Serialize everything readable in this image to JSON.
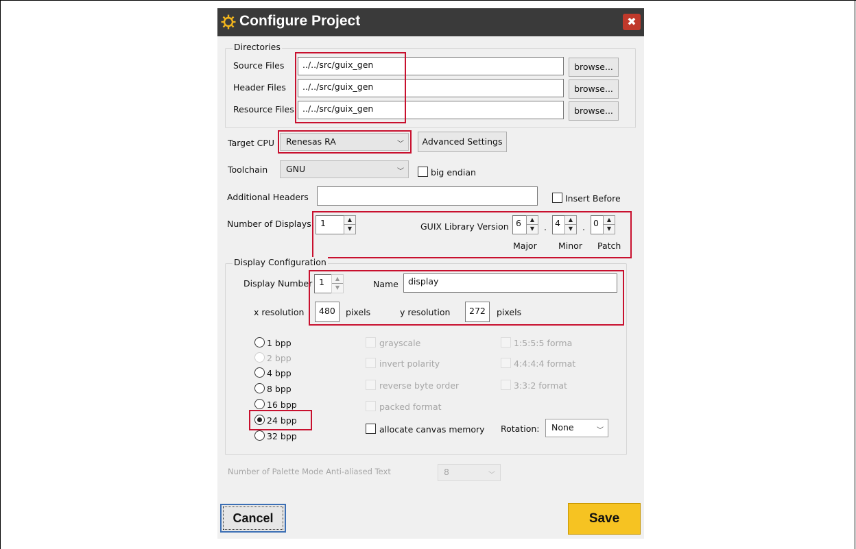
{
  "dialog": {
    "title": "Configure Project",
    "close_glyph": "✖"
  },
  "directories": {
    "group_label": "Directories",
    "source": {
      "label": "Source Files",
      "value": "../../src/guix_gen",
      "browse": "browse..."
    },
    "header": {
      "label": "Header Files",
      "value": "../../src/guix_gen",
      "browse": "browse..."
    },
    "resource": {
      "label": "Resource Files",
      "value": "../../src/guix_gen",
      "browse": "browse..."
    }
  },
  "target_cpu": {
    "label": "Target CPU",
    "value": "Renesas RA",
    "advanced": "Advanced Settings"
  },
  "toolchain": {
    "label": "Toolchain",
    "value": "GNU",
    "big_endian": "big endian"
  },
  "additional_headers": {
    "label": "Additional Headers",
    "value": "",
    "insert_before": "Insert Before"
  },
  "displays": {
    "label": "Number of Displays",
    "value": "1"
  },
  "guix_version": {
    "label": "GUIX Library Version",
    "major": "6",
    "minor": "4",
    "patch": "0",
    "sep": ".",
    "major_label": "Major",
    "minor_label": "Minor",
    "patch_label": "Patch"
  },
  "display_config": {
    "group_label": "Display Configuration",
    "number_label": "Display Number",
    "number_value": "1",
    "name_label": "Name",
    "name_value": "display",
    "xres_label": "x resolution",
    "xres_value": "480",
    "yres_label": "y resolution",
    "yres_value": "272",
    "pixels": "pixels",
    "bpp": [
      "1 bpp",
      "2 bpp",
      "4 bpp",
      "8 bpp",
      "16 bpp",
      "24 bpp",
      "32 bpp"
    ],
    "bpp_selected": "24 bpp",
    "options": [
      "grayscale",
      "invert polarity",
      "reverse byte order",
      "packed format"
    ],
    "formats": [
      "1:5:5:5 forma",
      "4:4:4:4 format",
      "3:3:2 format"
    ],
    "allocate_canvas": "allocate canvas memory",
    "rotation_label": "Rotation:",
    "rotation_value": "None"
  },
  "palette": {
    "label": "Number of Palette Mode Anti-aliased Text",
    "value": "8"
  },
  "buttons": {
    "cancel": "Cancel",
    "save": "Save"
  },
  "icons": {
    "title_icon": "gear-icon",
    "close": "close-icon"
  },
  "colors": {
    "highlight": "#c8102e",
    "save": "#f6c322",
    "titlebar": "#3a3a3a"
  }
}
